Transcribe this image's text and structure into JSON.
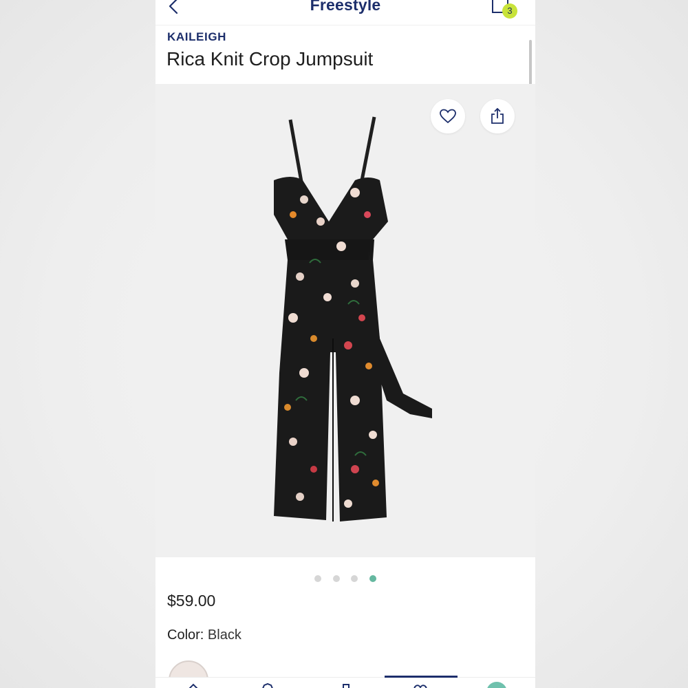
{
  "header": {
    "title": "Freestyle",
    "bag_count": "3"
  },
  "product": {
    "brand": "KAILEIGH",
    "name": "Rica Knit Crop Jumpsuit",
    "price": "$59.00",
    "color_label": "Color:",
    "color_value": "Black"
  },
  "gallery": {
    "image_count": 4,
    "active_index": 3
  },
  "colors": {
    "brand_navy": "#1c2e6b",
    "badge_green": "#c8e33a",
    "active_dot": "#65b8a0",
    "image_bg": "#f0f0f0"
  },
  "icons": [
    "back-chevron-icon",
    "shopping-bag-icon",
    "heart-icon",
    "share-icon"
  ]
}
